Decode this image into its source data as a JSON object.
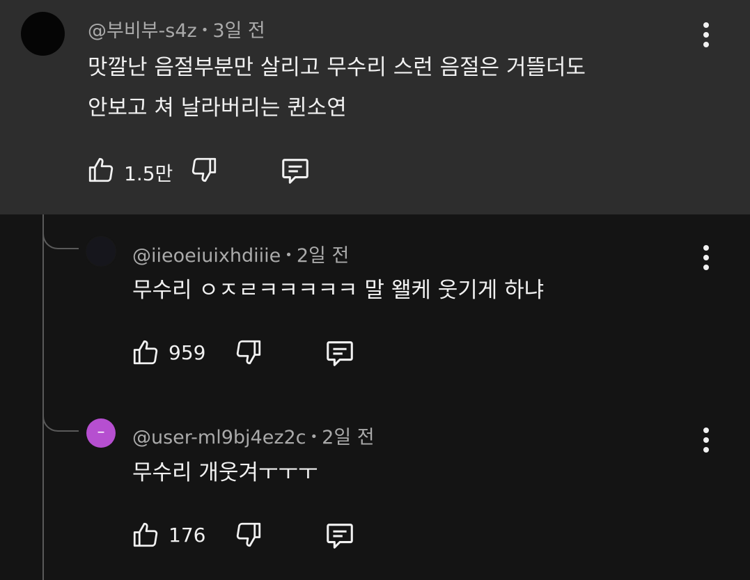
{
  "comments": [
    {
      "author": "@부비부-s4z",
      "time": "3일 전",
      "text_lines": [
        "맛깔난 음절부분만 살리고 무수리 스런 음절은 거뜰더도",
        "안보고 쳐 날라버리는 퀸소연"
      ],
      "likes": "1.5만"
    },
    {
      "author": "@iieoeiuixhdiiie",
      "time": "2일 전",
      "text_lines": [
        "무수리 ㅇㅈㄹㅋㅋㅋㅋㅋ 말 왤케 웃기게 하냐"
      ],
      "likes": "959"
    },
    {
      "author": "@user-ml9bj4ez2c",
      "time": "2일 전",
      "avatar_glyph": "–",
      "avatar_color": "#b64fd0",
      "text_lines": [
        "무수리 개웃겨ㅜㅜㅜ"
      ],
      "likes": "176"
    }
  ],
  "separator": "•",
  "icons": [
    "like-icon",
    "dislike-icon",
    "reply-icon",
    "more-options-icon"
  ]
}
